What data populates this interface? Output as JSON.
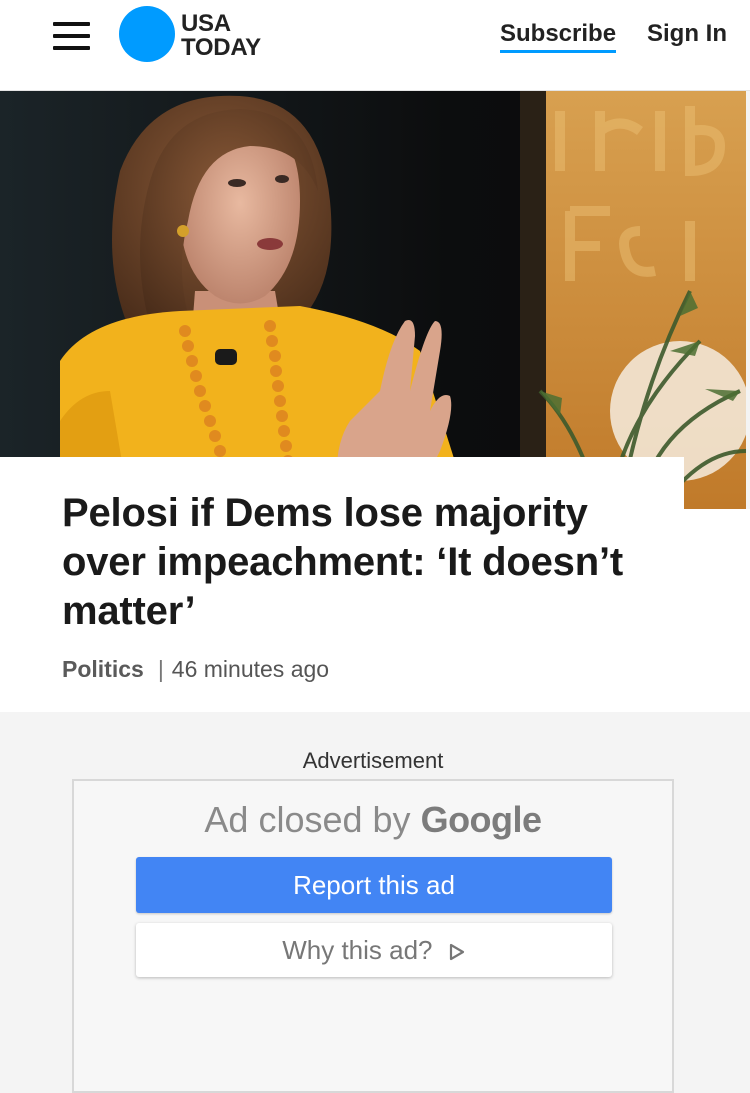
{
  "header": {
    "menu_icon": "hamburger-menu-icon",
    "logo": {
      "line1": "USA",
      "line2": "TODAY",
      "dot_color": "#009bff"
    },
    "subscribe_label": "Subscribe",
    "signin_label": "Sign In"
  },
  "hero": {
    "image": "photo-speaker-in-yellow-dress"
  },
  "article": {
    "headline": "Pelosi if Dems lose majority over impeachment: ‘It doesn’t matter’",
    "section": "Politics",
    "separator": "|",
    "timestamp": "46 minutes ago"
  },
  "ad": {
    "label": "Advertisement",
    "closed_text": "Ad closed by",
    "closed_brand": "Google",
    "report_label": "Report this ad",
    "why_label": "Why this ad?",
    "why_icon": "play-triangle-icon",
    "report_color": "#4285f4"
  },
  "colors": {
    "accent": "#009bff",
    "text": "#1a1a1a"
  }
}
